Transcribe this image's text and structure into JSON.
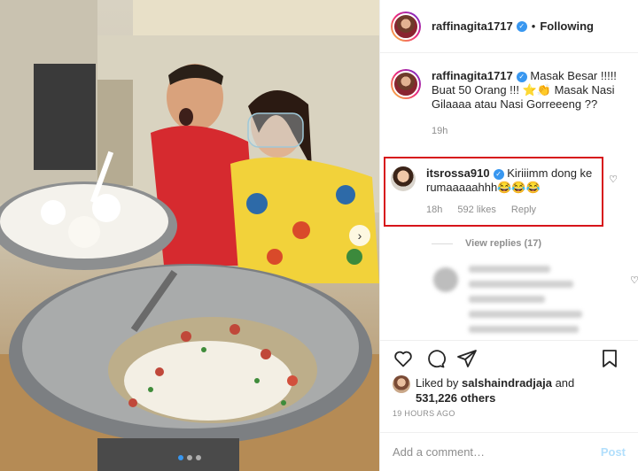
{
  "post": {
    "carousel": {
      "slide_count": 3,
      "active_index": 0
    },
    "header": {
      "username": "raffinagita1717",
      "verified": true,
      "separator": "•",
      "follow_status": "Following"
    },
    "caption": {
      "username": "raffinagita1717",
      "text": "Masak Besar !!!!! Buat 50 Orang !!! ⭐👏 Masak Nasi Gilaaaa atau Nasi Gorreeeng ??",
      "time": "19h"
    },
    "highlighted_comment": {
      "username": "itsrossa910",
      "verified": true,
      "text": "Kiriiimm dong ke rumaaaaahhh😂😂😂",
      "time": "18h",
      "likes": "592 likes",
      "reply_label": "Reply",
      "highlight_color": "#d7141a"
    },
    "view_replies": "View replies (17)",
    "likes": {
      "liked_by_prefix": "Liked by",
      "liked_by_user": "salshaindradjaja",
      "and": "and",
      "others": "531,226 others"
    },
    "timestamp": "19 HOURS AGO",
    "add_comment": {
      "placeholder": "Add a comment…",
      "post_label": "Post"
    },
    "icons": {
      "like": "heart-icon",
      "comment": "comment-icon",
      "share": "paper-plane-icon",
      "save": "bookmark-icon",
      "verified": "verified-badge-icon",
      "next": "chevron-right-icon"
    },
    "colors": {
      "accent": "#3897f0",
      "post_disabled": "#b2dffc",
      "text": "#262626",
      "secondary": "#8e8e8e"
    }
  }
}
